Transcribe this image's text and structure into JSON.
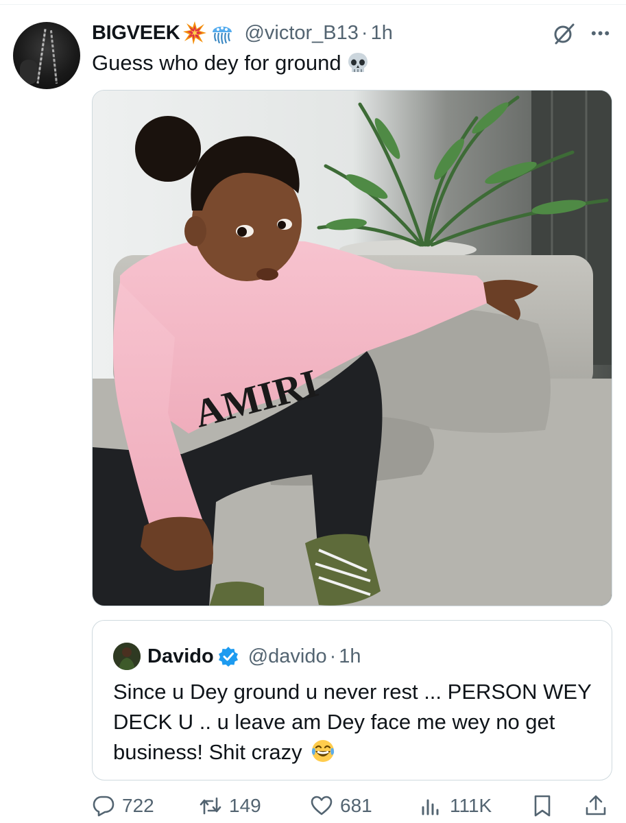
{
  "tweet": {
    "display_name": "BIGVEEK",
    "name_emojis": [
      "collision-emoji",
      "jellyfish-emoji"
    ],
    "handle": "@victor_B13",
    "separator": "·",
    "time": "1h",
    "text": "Guess who dey for ground",
    "text_emoji": "skull-emoji"
  },
  "quoted": {
    "display_name": "Davido",
    "verified": true,
    "handle": "@davido",
    "separator": "·",
    "time": "1h",
    "text": "Since u Dey ground u never rest ... PERSON WEY DECK U .. u leave am Dey face me wey no get business! Shit crazy",
    "text_emoji": "laughing-tears-emoji"
  },
  "photo": {
    "sweater_text": "AMIRI"
  },
  "actions": {
    "replies": "722",
    "reposts": "149",
    "likes": "681",
    "views": "111K"
  },
  "colors": {
    "text_primary": "#0f1419",
    "text_secondary": "#536471",
    "border": "#cfd9de",
    "verified_blue": "#1d9bf0"
  }
}
